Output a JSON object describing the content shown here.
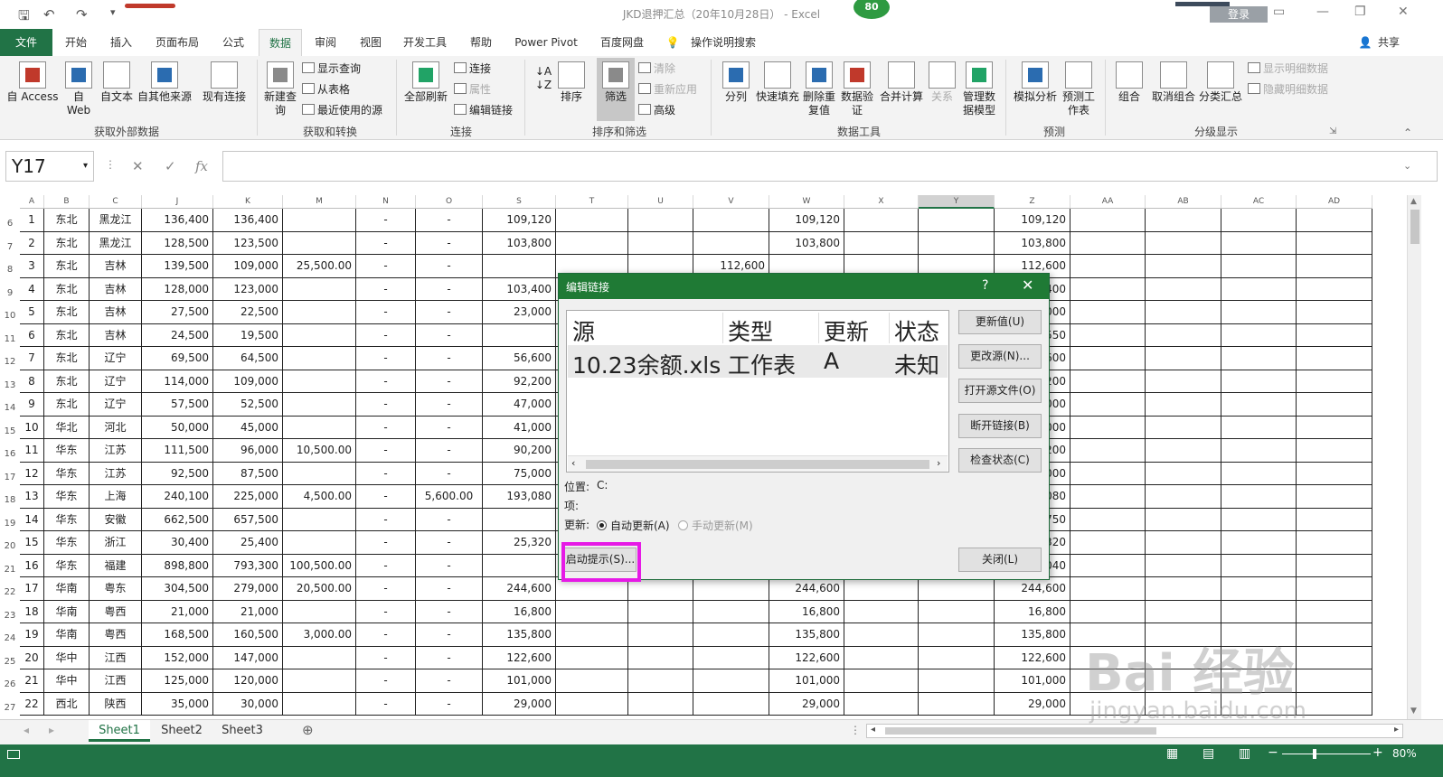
{
  "window": {
    "title": "JKD退押汇总（20年10月28日） - Excel",
    "login": "登录",
    "badge": "80"
  },
  "ribbon_tabs": [
    "文件",
    "开始",
    "插入",
    "页面布局",
    "公式",
    "数据",
    "审阅",
    "视图",
    "开发工具",
    "帮助",
    "Power Pivot",
    "百度网盘",
    "操作说明搜索",
    "共享"
  ],
  "ribbon": {
    "get_external": {
      "access": "自 Access",
      "web": "自 Web",
      "text": "自文本",
      "other": "自其他来源",
      "existing": "现有连接",
      "group": "获取外部数据"
    },
    "transform": {
      "new_query": "新建查询",
      "show_query": "显示查询",
      "from_table": "从表格",
      "recent": "最近使用的源",
      "group": "获取和转换"
    },
    "connections": {
      "refresh_all": "全部刷新",
      "connections": "连接",
      "properties": "属性",
      "edit_links": "编辑链接",
      "group": "连接"
    },
    "sort_filter": {
      "sort": "排序",
      "filter": "筛选",
      "clear": "清除",
      "reapply": "重新应用",
      "advanced": "高级",
      "group": "排序和筛选"
    },
    "data_tools": {
      "split": "分列",
      "flash_fill": "快速填充",
      "remove_dup": "删除重复值",
      "validation": "数据验证",
      "consolidate": "合并计算",
      "relations": "关系",
      "manage_model": "管理数据模型",
      "group": "数据工具"
    },
    "forecast": {
      "whatif": "模拟分析",
      "forecast_sheet": "预测工作表",
      "group": "预测"
    },
    "outline": {
      "group_btn": "组合",
      "ungroup": "取消组合",
      "subtotal": "分类汇总",
      "show_detail": "显示明细数据",
      "hide_detail": "隐藏明细数据",
      "group": "分级显示"
    }
  },
  "formula_bar": {
    "name_box": "Y17",
    "fx": "fx",
    "content": ""
  },
  "columns": [
    "A",
    "B",
    "C",
    "J",
    "K",
    "M",
    "N",
    "O",
    "S",
    "T",
    "U",
    "V",
    "W",
    "X",
    "Y",
    "Z",
    "AA",
    "AB",
    "AC",
    "AD"
  ],
  "rows": [
    {
      "n": "6",
      "a": "1",
      "b": "东北",
      "c": "黑龙江",
      "j": "136,400",
      "k": "136,400",
      "m": "",
      "nn": "-",
      "o": "-",
      "s": "109,120",
      "v": "",
      "w": "109,120",
      "z": "109,120"
    },
    {
      "n": "7",
      "a": "2",
      "b": "东北",
      "c": "黑龙江",
      "j": "128,500",
      "k": "123,500",
      "m": "",
      "nn": "-",
      "o": "-",
      "s": "103,800",
      "v": "",
      "w": "103,800",
      "z": "103,800"
    },
    {
      "n": "8",
      "a": "3",
      "b": "东北",
      "c": "吉林",
      "j": "139,500",
      "k": "109,000",
      "m": "25,500.00",
      "nn": "-",
      "o": "-",
      "s": "",
      "v": "112,600",
      "w": "",
      "z": "112,600"
    },
    {
      "n": "9",
      "a": "4",
      "b": "东北",
      "c": "吉林",
      "j": "128,000",
      "k": "123,000",
      "m": "",
      "nn": "-",
      "o": "-",
      "s": "103,400",
      "v": "",
      "w": "",
      "z": "400"
    },
    {
      "n": "10",
      "a": "5",
      "b": "东北",
      "c": "吉林",
      "j": "27,500",
      "k": "22,500",
      "m": "",
      "nn": "-",
      "o": "-",
      "s": "23,000",
      "v": "",
      "w": "",
      "z": "000"
    },
    {
      "n": "11",
      "a": "6",
      "b": "东北",
      "c": "吉林",
      "j": "24,500",
      "k": "19,500",
      "m": "",
      "nn": "-",
      "o": "-",
      "s": "",
      "v": "",
      "w": "",
      "z": "550"
    },
    {
      "n": "12",
      "a": "7",
      "b": "东北",
      "c": "辽宁",
      "j": "69,500",
      "k": "64,500",
      "m": "",
      "nn": "-",
      "o": "-",
      "s": "56,600",
      "v": "",
      "w": "",
      "z": "600"
    },
    {
      "n": "13",
      "a": "8",
      "b": "东北",
      "c": "辽宁",
      "j": "114,000",
      "k": "109,000",
      "m": "",
      "nn": "-",
      "o": "-",
      "s": "92,200",
      "v": "",
      "w": "",
      "z": "200"
    },
    {
      "n": "14",
      "a": "9",
      "b": "东北",
      "c": "辽宁",
      "j": "57,500",
      "k": "52,500",
      "m": "",
      "nn": "-",
      "o": "-",
      "s": "47,000",
      "v": "",
      "w": "",
      "z": "000"
    },
    {
      "n": "15",
      "a": "10",
      "b": "华北",
      "c": "河北",
      "j": "50,000",
      "k": "45,000",
      "m": "",
      "nn": "-",
      "o": "-",
      "s": "41,000",
      "v": "",
      "w": "",
      "z": "000"
    },
    {
      "n": "16",
      "a": "11",
      "b": "华东",
      "c": "江苏",
      "j": "111,500",
      "k": "96,000",
      "m": "10,500.00",
      "nn": "-",
      "o": "-",
      "s": "90,200",
      "v": "",
      "w": "",
      "z": "200"
    },
    {
      "n": "17",
      "a": "12",
      "b": "华东",
      "c": "江苏",
      "j": "92,500",
      "k": "87,500",
      "m": "",
      "nn": "-",
      "o": "-",
      "s": "75,000",
      "v": "",
      "w": "",
      "z": "000"
    },
    {
      "n": "18",
      "a": "13",
      "b": "华东",
      "c": "上海",
      "j": "240,100",
      "k": "225,000",
      "m": "4,500.00",
      "nn": "-",
      "o": "5,600.00",
      "s": "193,080",
      "v": "",
      "w": "",
      "z": "080"
    },
    {
      "n": "19",
      "a": "14",
      "b": "华东",
      "c": "安徽",
      "j": "662,500",
      "k": "657,500",
      "m": "",
      "nn": "-",
      "o": "-",
      "s": "",
      "v": "",
      "w": "",
      "z": "750"
    },
    {
      "n": "20",
      "a": "15",
      "b": "华东",
      "c": "浙江",
      "j": "30,400",
      "k": "25,400",
      "m": "",
      "nn": "-",
      "o": "-",
      "s": "25,320",
      "v": "",
      "w": "",
      "z": "320"
    },
    {
      "n": "21",
      "a": "16",
      "b": "华东",
      "c": "福建",
      "j": "898,800",
      "k": "793,300",
      "m": "100,500.00",
      "nn": "-",
      "o": "-",
      "s": "",
      "v": "",
      "w": "",
      "z": "040"
    },
    {
      "n": "22",
      "a": "17",
      "b": "华南",
      "c": "粤东",
      "j": "304,500",
      "k": "279,000",
      "m": "20,500.00",
      "nn": "-",
      "o": "-",
      "s": "244,600",
      "v": "",
      "w": "244,600",
      "z": "244,600"
    },
    {
      "n": "23",
      "a": "18",
      "b": "华南",
      "c": "粤西",
      "j": "21,000",
      "k": "21,000",
      "m": "",
      "nn": "-",
      "o": "-",
      "s": "16,800",
      "v": "",
      "w": "16,800",
      "z": "16,800"
    },
    {
      "n": "24",
      "a": "19",
      "b": "华南",
      "c": "粤西",
      "j": "168,500",
      "k": "160,500",
      "m": "3,000.00",
      "nn": "-",
      "o": "-",
      "s": "135,800",
      "v": "",
      "w": "135,800",
      "z": "135,800"
    },
    {
      "n": "25",
      "a": "20",
      "b": "华中",
      "c": "江西",
      "j": "152,000",
      "k": "147,000",
      "m": "",
      "nn": "-",
      "o": "-",
      "s": "122,600",
      "v": "",
      "w": "122,600",
      "z": "122,600"
    },
    {
      "n": "26",
      "a": "21",
      "b": "华中",
      "c": "江西",
      "j": "125,000",
      "k": "120,000",
      "m": "",
      "nn": "-",
      "o": "-",
      "s": "101,000",
      "v": "",
      "w": "101,000",
      "z": "101,000"
    },
    {
      "n": "27",
      "a": "22",
      "b": "西北",
      "c": "陕西",
      "j": "35,000",
      "k": "30,000",
      "m": "",
      "nn": "-",
      "o": "-",
      "s": "29,000",
      "v": "",
      "w": "29,000",
      "z": "29,000"
    }
  ],
  "sheets": [
    "Sheet1",
    "Sheet2",
    "Sheet3"
  ],
  "status": {
    "zoom": "80%"
  },
  "dialog": {
    "title": "编辑链接",
    "help": "?",
    "headers": [
      "源",
      "类型",
      "更新",
      "状态"
    ],
    "link": {
      "source": "10.23余额.xls",
      "type": "工作表",
      "update": "A",
      "status": "未知"
    },
    "buttons": {
      "update_values": "更新值(U)",
      "change_source": "更改源(N)...",
      "open_source": "打开源文件(O)",
      "break_link": "断开链接(B)",
      "check_status": "检查状态(C)",
      "close": "关闭(L)",
      "startup": "启动提示(S)..."
    },
    "location_label": "位置:",
    "location_value": "C:",
    "item_label": "项:",
    "update_label": "更新:",
    "auto_update": "自动更新(A)",
    "manual_update": "手动更新(M)"
  },
  "watermark": {
    "main": "Bai 经验",
    "url": "jingyan.baidu.com"
  }
}
